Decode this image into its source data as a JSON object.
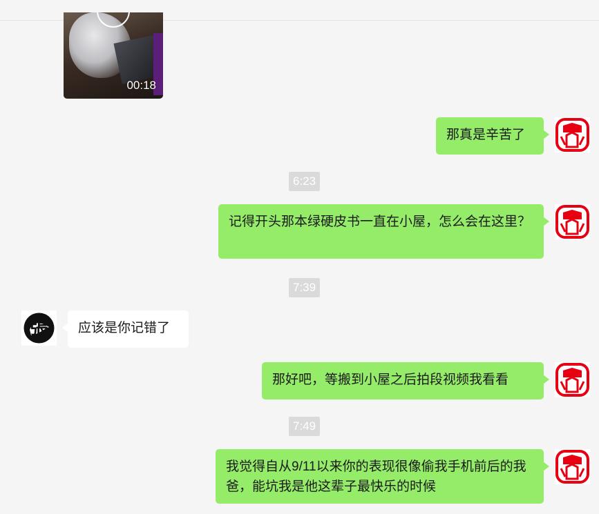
{
  "video": {
    "duration": "00:18"
  },
  "messages": [
    {
      "kind": "mine",
      "text": "那真是辛苦了"
    },
    {
      "kind": "time",
      "text": "6:23"
    },
    {
      "kind": "mine",
      "text": "记得开头那本绿硬皮书一直在小屋，怎么会在这里？"
    },
    {
      "kind": "time",
      "text": "7:39"
    },
    {
      "kind": "theirs",
      "text": "应该是你记错了"
    },
    {
      "kind": "mine",
      "text": "那好吧，等搬到小屋之后拍段视频我看看"
    },
    {
      "kind": "time",
      "text": "7:49"
    },
    {
      "kind": "mine",
      "text": "我觉得自从9/11以来你的表现很像偷我手机前后的我爸，能坑我是他这辈子最快乐的时候"
    }
  ],
  "avatars": {
    "mine": {
      "icon": "red-seal-logo-icon",
      "color": "#e60012"
    },
    "theirs": {
      "icon": "calligraphy-character-icon",
      "color": "#111111"
    }
  },
  "colors": {
    "mine_bubble": "#95ec69",
    "theirs_bubble": "#ffffff",
    "time_pill": "#dadada",
    "background": "#f5f5f5"
  }
}
